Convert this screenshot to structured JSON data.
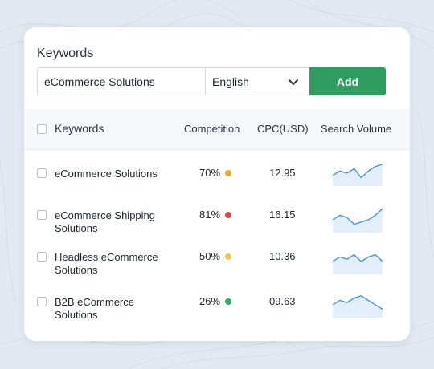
{
  "card": {
    "title": "Keywords"
  },
  "search": {
    "keyword_value": "eCommerce Solutions",
    "language": "English",
    "add_label": "Add"
  },
  "table": {
    "headers": {
      "keywords": "Keywords",
      "competition": "Competition",
      "cpc": "CPC(USD)",
      "volume": "Search Volume"
    },
    "rows": [
      {
        "name": "eCommerce Solutions",
        "competition": "70%",
        "competition_color": "#f5a623",
        "cpc": "12.95",
        "trend": [
          4,
          6,
          5,
          7,
          3,
          6,
          8,
          9
        ]
      },
      {
        "name": "eCommerce Shipping Solutions",
        "competition": "81%",
        "competition_color": "#e2453c",
        "cpc": "16.15",
        "trend": [
          5,
          7,
          6,
          3,
          4,
          5,
          7,
          10
        ]
      },
      {
        "name": "Headless eCommerce Solutions",
        "competition": "50%",
        "competition_color": "#f2c94c",
        "cpc": "10.36",
        "trend": [
          5,
          7,
          6,
          8,
          5,
          7,
          8,
          5
        ]
      },
      {
        "name": "B2B eCommerce Solutions",
        "competition": "26%",
        "competition_color": "#27ae60",
        "cpc": "09.63",
        "trend": [
          5,
          7,
          6,
          8,
          9,
          7,
          5,
          3
        ]
      }
    ]
  },
  "colors": {
    "accent": "#2e9d5f",
    "spark_line": "#3d8fe0",
    "spark_fill": "#e3effb"
  }
}
